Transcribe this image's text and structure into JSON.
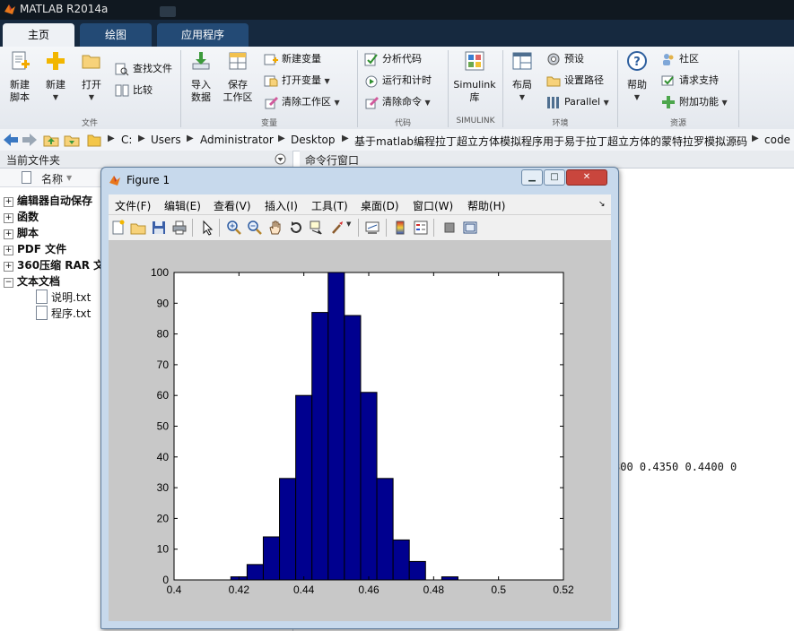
{
  "app": {
    "title": "MATLAB R2014a",
    "tabs": [
      {
        "label": "主页",
        "active": true
      },
      {
        "label": "绘图",
        "active": false
      },
      {
        "label": "应用程序",
        "active": false
      }
    ]
  },
  "ribbon": {
    "file_group": {
      "label": "文件",
      "new_script": "新建\n脚本",
      "new": "新建",
      "open": "打开",
      "find_files": "查找文件",
      "compare": "比较"
    },
    "variable_group": {
      "label": "变量",
      "import_data": "导入\n数据",
      "save_workspace": "保存\n工作区",
      "new_variable": "新建变量",
      "open_variable": "打开变量",
      "clear_workspace": "清除工作区"
    },
    "code_group": {
      "label": "代码",
      "analyze_code": "分析代码",
      "run_and_time": "运行和计时",
      "clear_commands": "清除命令"
    },
    "simulink_group": {
      "label": "SIMULINK",
      "simulink_library": "Simulink\n库"
    },
    "environment_group": {
      "label": "环境",
      "layout": "布局",
      "preferences": "预设",
      "set_path": "设置路径",
      "parallel": "Parallel"
    },
    "resources_group": {
      "label": "资源",
      "help": "帮助",
      "community": "社区",
      "request_support": "请求支持",
      "addons": "附加功能"
    }
  },
  "address_bar": {
    "crumbs": [
      "C:",
      "Users",
      "Administrator",
      "Desktop",
      "基于matlab编程拉丁超立方体模拟程序用于易于拉丁超立方体的蒙特拉罗模拟源码",
      "code"
    ]
  },
  "current_folder": {
    "title": "当前文件夹",
    "name_column": "名称",
    "tree": [
      {
        "label": "编辑器自动保存",
        "expanded": false
      },
      {
        "label": "函数",
        "expanded": false
      },
      {
        "label": "脚本",
        "expanded": false
      },
      {
        "label": "PDF 文件",
        "expanded": false
      },
      {
        "label": "360压缩 RAR 文件",
        "expanded": false
      },
      {
        "label": "文本文档",
        "expanded": true
      }
    ],
    "files": [
      "说明.txt",
      "程序.txt"
    ]
  },
  "command_window": {
    "title": "命令行窗口",
    "output_line": "300    0.4350    0.4400    0"
  },
  "figure": {
    "title": "Figure 1",
    "menu": [
      "文件(F)",
      "编辑(E)",
      "查看(V)",
      "插入(I)",
      "工具(T)",
      "桌面(D)",
      "窗口(W)",
      "帮助(H)"
    ],
    "toolbar_icons": [
      "new-figure-icon",
      "open-file-icon",
      "save-icon",
      "print-icon",
      "select-arrow-icon",
      "zoom-in-icon",
      "zoom-out-icon",
      "pan-hand-icon",
      "rotate-3d-icon",
      "data-cursor-icon",
      "brush-icon",
      "link-plot-icon",
      "colorbar-icon",
      "legend-icon",
      "hide-plot-tools-icon",
      "show-plot-tools-icon"
    ],
    "colors": {
      "bar_fill": "#00008f",
      "bar_edge": "#000000",
      "figure_bg": "#c8c8c8",
      "axes_bg": "#ffffff"
    }
  },
  "chart_data": {
    "type": "bar",
    "title": "",
    "xlabel": "",
    "ylabel": "",
    "xlim": [
      0.4,
      0.52
    ],
    "ylim": [
      0,
      100
    ],
    "xticks": [
      0.4,
      0.42,
      0.44,
      0.46,
      0.48,
      0.5,
      0.52
    ],
    "xtick_labels": [
      "0.4",
      "0.42",
      "0.44",
      "0.46",
      "0.48",
      "0.5",
      "0.52"
    ],
    "yticks": [
      0,
      10,
      20,
      30,
      40,
      50,
      60,
      70,
      80,
      90,
      100
    ],
    "ytick_labels": [
      "0",
      "10",
      "20",
      "30",
      "40",
      "50",
      "60",
      "70",
      "80",
      "90",
      "100"
    ],
    "bin_width": 0.005,
    "bin_starts": [
      0.4175,
      0.4225,
      0.4275,
      0.4325,
      0.4375,
      0.4425,
      0.4475,
      0.4525,
      0.4575,
      0.4625,
      0.4675,
      0.4725,
      0.4775,
      0.4825
    ],
    "values": [
      1,
      5,
      14,
      33,
      60,
      87,
      100,
      86,
      61,
      33,
      13,
      6,
      0,
      1
    ],
    "grid": false
  }
}
